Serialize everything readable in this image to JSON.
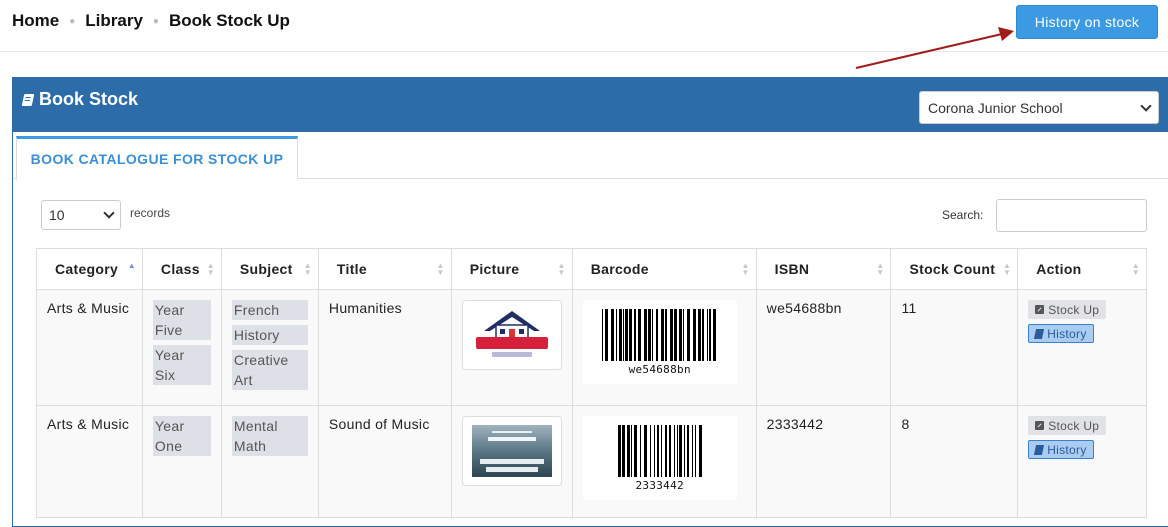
{
  "breadcrumb": {
    "home": "Home",
    "library": "Library",
    "current": "Book Stock Up"
  },
  "header_button": "History on stock",
  "panel": {
    "title": "Book Stock",
    "icon": "book-icon",
    "school": "Corona Junior School"
  },
  "tab": {
    "label": "BOOK CATALOGUE FOR STOCK UP"
  },
  "controls": {
    "page_length": "10",
    "records_label": "records",
    "search_label": "Search:",
    "search_value": ""
  },
  "table": {
    "columns": [
      "Category",
      "Class",
      "Subject",
      "Title",
      "Picture",
      "Barcode",
      "ISBN",
      "Stock Count",
      "Action"
    ],
    "sorted_column": "Category",
    "rows": [
      {
        "category": "Arts & Music",
        "classes": [
          "Year Five",
          "Year Six"
        ],
        "subjects": [
          "French",
          "History",
          "Creative Art"
        ],
        "title": "Humanities",
        "picture": "wisville-academy-logo",
        "barcode": "we54688bn",
        "isbn": "we54688bn",
        "stock_count": "11",
        "actions": {
          "stock_up": "Stock Up",
          "history": "History"
        }
      },
      {
        "category": "Arts & Music",
        "classes": [
          "Year One"
        ],
        "subjects": [
          "Mental Math"
        ],
        "title": "Sound of Music",
        "picture": "book-cover-the-king-of-drugs",
        "barcode": "2333442",
        "isbn": "2333442",
        "stock_count": "8",
        "actions": {
          "stock_up": "Stock Up",
          "history": "History"
        }
      }
    ]
  },
  "colors": {
    "header_blue": "#2c6ca9",
    "accent": "#3b9ae1",
    "arrow": "#a01c1c"
  }
}
